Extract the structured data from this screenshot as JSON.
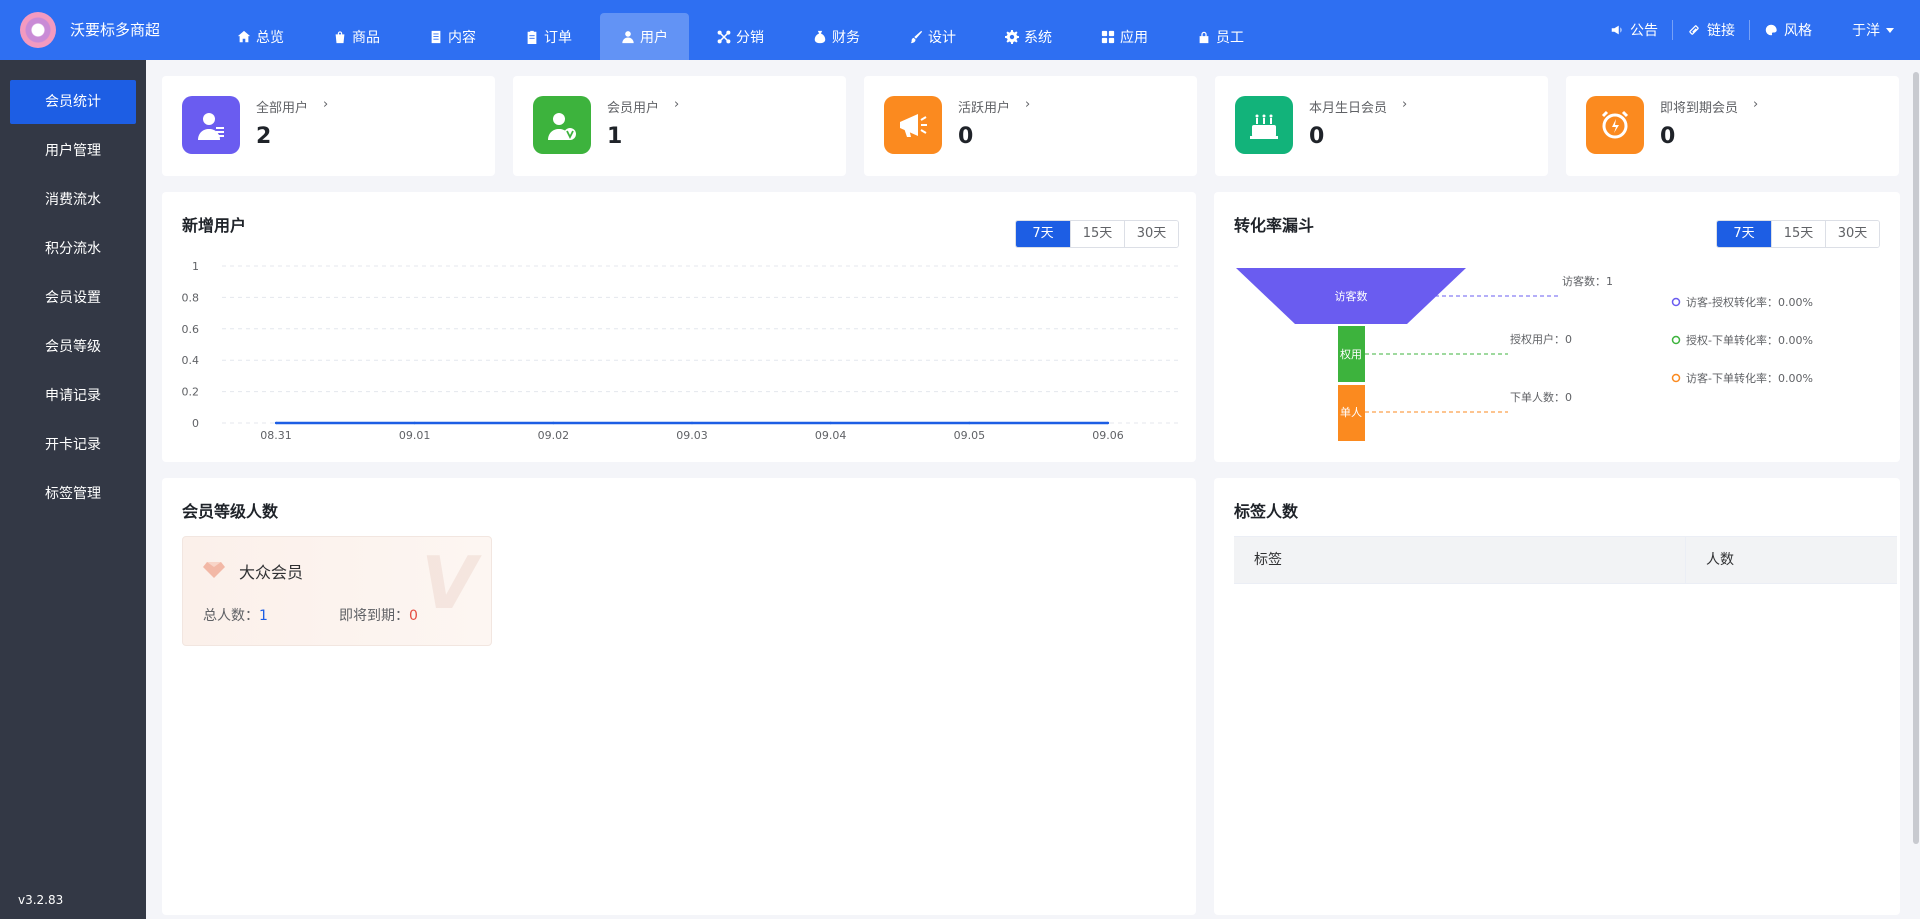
{
  "app": {
    "title": "沃要标多商超"
  },
  "nav": [
    {
      "label": "总览",
      "icon": "home-icon"
    },
    {
      "label": "商品",
      "icon": "bag-icon"
    },
    {
      "label": "内容",
      "icon": "document-icon"
    },
    {
      "label": "订单",
      "icon": "clipboard-icon"
    },
    {
      "label": "用户",
      "icon": "user-icon",
      "active": true
    },
    {
      "label": "分销",
      "icon": "network-icon"
    },
    {
      "label": "财务",
      "icon": "money-bag-icon"
    },
    {
      "label": "设计",
      "icon": "brush-icon"
    },
    {
      "label": "系统",
      "icon": "gear-icon"
    },
    {
      "label": "应用",
      "icon": "grid-icon"
    },
    {
      "label": "员工",
      "icon": "lock-icon"
    }
  ],
  "topRight": {
    "notice": "公告",
    "link": "链接",
    "style": "风格",
    "user": "于洋"
  },
  "sidebar": {
    "items": [
      "会员统计",
      "用户管理",
      "消费流水",
      "积分流水",
      "会员设置",
      "会员等级",
      "申请记录",
      "开卡记录",
      "标签管理"
    ],
    "version": "v3.2.83"
  },
  "stats": [
    {
      "label": "全部用户",
      "value": "2",
      "color": "#6a5cf0",
      "icon": "user-list-icon"
    },
    {
      "label": "会员用户",
      "value": "1",
      "color": "#3db33d",
      "icon": "vip-user-icon"
    },
    {
      "label": "活跃用户",
      "value": "0",
      "color": "#fb8a1f",
      "icon": "megaphone-icon"
    },
    {
      "label": "本月生日会员",
      "value": "0",
      "color": "#12b37a",
      "icon": "cake-icon"
    },
    {
      "label": "即将到期会员",
      "value": "0",
      "color": "#fb8a1f",
      "icon": "alarm-clock-icon"
    }
  ],
  "newUsers": {
    "title": "新增用户",
    "ranges": [
      "7天",
      "15天",
      "30天"
    ]
  },
  "chart_data": {
    "type": "line",
    "title": "",
    "categories": [
      "08.31",
      "09.01",
      "09.02",
      "09.03",
      "09.04",
      "09.05",
      "09.06"
    ],
    "series": [
      {
        "values": [
          0,
          0,
          0,
          0,
          0,
          0,
          0
        ]
      }
    ],
    "yTicks": [
      "1",
      "0.8",
      "0.6",
      "0.4",
      "0.2",
      "0"
    ],
    "ylim": [
      0,
      1
    ],
    "grid": true,
    "color": "#1d5ee4"
  },
  "funnel": {
    "title": "转化率漏斗",
    "ranges": [
      "7天",
      "15天",
      "30天"
    ],
    "stages": [
      {
        "label": "访客数",
        "note": "访客数：1",
        "color": "#6a5cf0"
      },
      {
        "label": "授权用户",
        "note": "授权用户：0",
        "color": "#3db33d"
      },
      {
        "label": "下单人数",
        "note": "下单人数：0",
        "color": "#fb8a1f"
      }
    ],
    "stageBarText": [
      "访客数",
      "权用",
      "单人"
    ],
    "rates": [
      {
        "text": "访客-授权转化率：0.00%",
        "color": "#6a5cf0"
      },
      {
        "text": "授权-下单转化率：0.00%",
        "color": "#3db33d"
      },
      {
        "text": "访客-下单转化率：0.00%",
        "color": "#fb8a1f"
      }
    ]
  },
  "memberLevels": {
    "title": "会员等级人数",
    "card": {
      "name": "大众会员",
      "totalLabel": "总人数：",
      "total": "1",
      "expiringLabel": "即将到期：",
      "expiring": "0",
      "watermark": "V"
    }
  },
  "tags": {
    "title": "标签人数",
    "columns": [
      "标签",
      "人数"
    ]
  }
}
